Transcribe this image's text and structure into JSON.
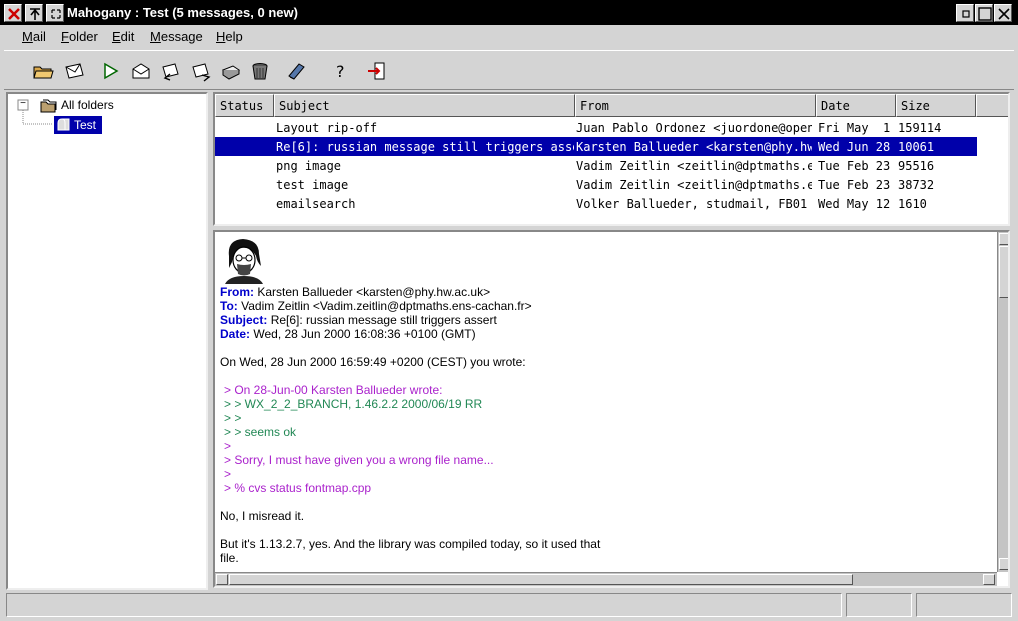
{
  "window": {
    "title": "Mahogany : Test (5 messages, 0 new)"
  },
  "menubar": {
    "items": [
      {
        "u": "M",
        "rest": "ail"
      },
      {
        "u": "F",
        "rest": "older"
      },
      {
        "u": "E",
        "rest": "dit"
      },
      {
        "u": "M",
        "rest": "essage"
      },
      {
        "u": "H",
        "rest": "elp"
      }
    ]
  },
  "tree": {
    "root_label": "All folders",
    "child_label": "Test",
    "expander": "−"
  },
  "message_list": {
    "columns": [
      "Status",
      "Subject",
      "From",
      "Date",
      "Size"
    ],
    "rows": [
      {
        "status": "",
        "subject": "Layout rip-off",
        "from": "Juan Pablo Ordonez <juordone@openw",
        "date": "Fri May  1",
        "size": "159114"
      },
      {
        "status": "",
        "subject": "Re[6]: russian message still triggers asse",
        "from": "Karsten Ballueder <karsten@phy.hw.",
        "date": "Wed Jun 28",
        "size": "10061"
      },
      {
        "status": "",
        "subject": "png image",
        "from": "Vadim Zeitlin <zeitlin@dptmaths.er",
        "date": "Tue Feb 23",
        "size": "95516"
      },
      {
        "status": "",
        "subject": "test image",
        "from": "Vadim Zeitlin <zeitlin@dptmaths.er",
        "date": "Tue Feb 23",
        "size": "38732"
      },
      {
        "status": "",
        "subject": "emailsearch",
        "from": "Volker Ballueder, studmail, FB01 ‹",
        "date": "Wed May 12",
        "size": "1610"
      }
    ]
  },
  "viewer": {
    "from_label": "From:",
    "from_value": "Karsten Ballueder <karsten@phy.hw.ac.uk>",
    "to_label": "To:",
    "to_value": "Vadim Zeitlin <Vadim.zeitlin@dptmaths.ens-cachan.fr>",
    "subject_label": "Subject:",
    "subject_value": "Re[6]: russian message still triggers assert",
    "date_label": "Date:",
    "date_value": "Wed, 28 Jun 2000 16:08:36 +0100 (GMT)",
    "intro": "On Wed, 28 Jun 2000 16:59:49 +0200 (CEST) you wrote:",
    "quote1": "> On 28-Jun-00 Karsten Ballueder wrote:",
    "quote2": "> > WX_2_2_BRANCH, 1.46.2.2 2000/06/19 RR",
    "quote3": "> >",
    "quote4": "> > seems ok",
    "quote5": ">",
    "quote6": ">  Sorry, I must have given you a wrong file name...",
    "quote7": ">",
    "quote8": "> % cvs status fontmap.cpp",
    "body1": "No, I misread it.",
    "body2": "But it's 1.13.2.7, yes. And the library was compiled today, so it used that",
    "body3": "file."
  },
  "statusbar": {
    "main": "",
    "pane2": "",
    "pane3": ""
  }
}
